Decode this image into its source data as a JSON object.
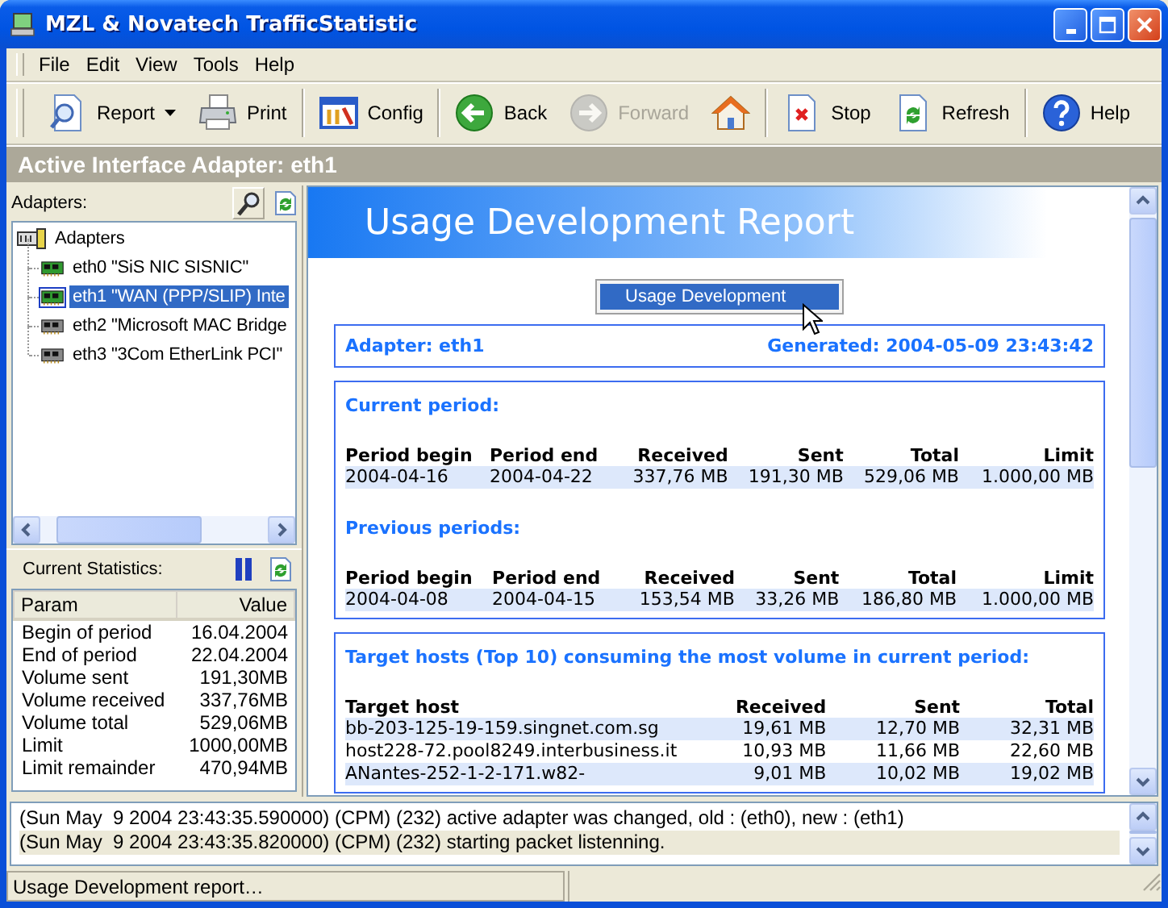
{
  "window": {
    "title": "MZL & Novatech TrafficStatistic"
  },
  "menu": [
    "File",
    "Edit",
    "View",
    "Tools",
    "Help"
  ],
  "toolbar": {
    "groups": [
      [
        {
          "label": "Report",
          "dropdown": true,
          "disabled": false
        },
        {
          "label": "Print",
          "dropdown": false,
          "disabled": false
        }
      ],
      [
        {
          "label": "Config",
          "dropdown": false,
          "disabled": false
        }
      ],
      [
        {
          "label": "Back",
          "dropdown": false,
          "disabled": false
        },
        {
          "label": "Forward",
          "dropdown": false,
          "disabled": true
        },
        {
          "dropdown": false,
          "disabled": false
        }
      ],
      [
        {
          "label": "Stop",
          "dropdown": false,
          "disabled": false
        },
        {
          "label": "Refresh",
          "dropdown": false,
          "disabled": false
        }
      ],
      [
        {
          "label": "Help",
          "dropdown": false,
          "disabled": false
        }
      ]
    ]
  },
  "active_adapter": "Active Interface Adapter: eth1",
  "adapters_panel": {
    "label": "Adapters:",
    "tree": {
      "label": "Adapters",
      "children": [
        {
          "label": "eth0 \"SiS NIC SISNIC\"",
          "active": true,
          "selected": false
        },
        {
          "label": "eth1 \"WAN (PPP/SLIP) Inte",
          "active": true,
          "selected": true
        },
        {
          "label": "eth2 \"Microsoft MAC Bridge",
          "active": false,
          "selected": false
        },
        {
          "label": "eth3 \"3Com EtherLink PCI\"",
          "active": false,
          "selected": false
        }
      ]
    }
  },
  "statistics": {
    "label": "Current Statistics:",
    "columns": [
      "Param",
      "Value"
    ],
    "rows": [
      [
        "Begin of period",
        "16.04.2004"
      ],
      [
        "End of period",
        "22.04.2004"
      ],
      [
        "Volume sent",
        "191,30MB"
      ],
      [
        "Volume received",
        "337,76MB"
      ],
      [
        "Volume total",
        "529,06MB"
      ],
      [
        "Limit",
        "1000,00MB"
      ],
      [
        "Limit remainder",
        "470,94MB"
      ]
    ]
  },
  "report": {
    "title": "Usage Development Report",
    "button": "Usage Development",
    "adapter": "Adapter: eth1",
    "generated": "Generated: 2004-05-09 23:43:42",
    "period_box": [
      {
        "heading": "Current period:",
        "columns": [
          "Period begin",
          "Period end",
          "Received",
          "Sent",
          "Total",
          "Limit"
        ],
        "rows": [
          [
            "2004-04-16",
            "2004-04-22",
            "337,76 MB",
            "191,30 MB",
            "529,06 MB",
            "1.000,00 MB"
          ]
        ]
      },
      {
        "heading": "Previous periods:",
        "columns": [
          "Period begin",
          "Period end",
          "Received",
          "Sent",
          "Total",
          "Limit"
        ],
        "rows": [
          [
            "2004-04-08",
            "2004-04-15",
            "153,54 MB",
            "33,26 MB",
            "186,80 MB",
            "1.000,00 MB"
          ]
        ]
      }
    ],
    "hosts_box": {
      "heading": "Target hosts (Top 10) consuming the most volume in current period:",
      "columns": [
        "Target host",
        "Received",
        "Sent",
        "Total"
      ],
      "rows": [
        [
          "bb-203-125-19-159.singnet.com.sg",
          "19,61 MB",
          "12,70 MB",
          "32,31 MB"
        ],
        [
          "host228-72.pool8249.interbusiness.it",
          "10,93 MB",
          "11,66 MB",
          "22,60 MB"
        ],
        [
          "ANantes-252-1-2-171.w82-",
          "9,01 MB",
          "10,02 MB",
          "19,02 MB"
        ]
      ]
    }
  },
  "log": [
    {
      "text": "(Sun May  9 2004 23:43:35.590000) (CPM) (232) active adapter was changed, old : (eth0), new : (eth1)",
      "selected": false
    },
    {
      "text": "(Sun May  9 2004 23:43:35.820000) (CPM) (232) starting packet listenning.",
      "selected": true
    }
  ],
  "status_bar": {
    "text": "Usage Development report…"
  }
}
